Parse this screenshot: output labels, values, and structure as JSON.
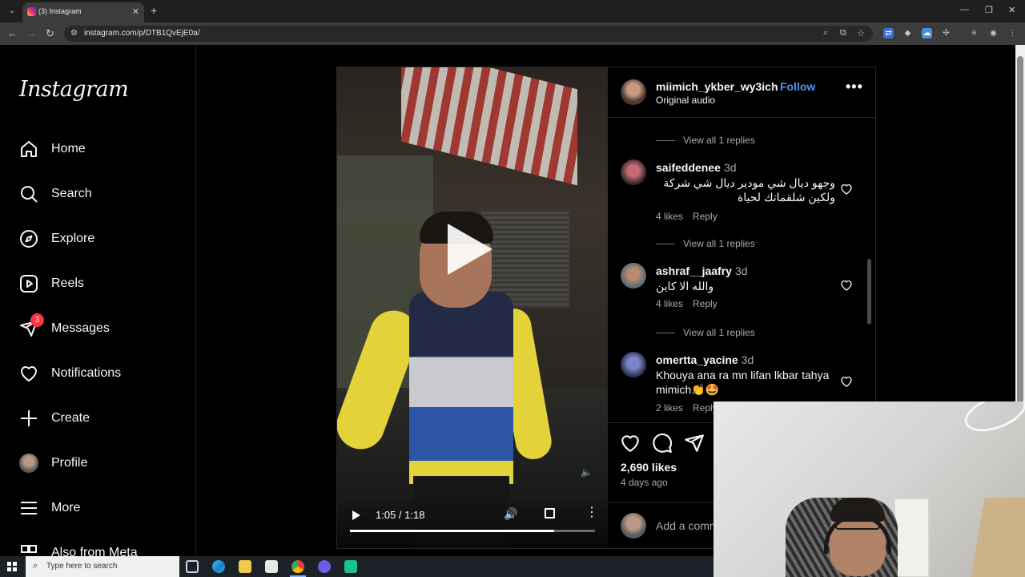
{
  "browser": {
    "tab_title": "(3) Instagram",
    "url": "instagram.com/p/DTB1QvEjE0a/"
  },
  "sidebar": {
    "logo": "Instagram",
    "items": [
      {
        "label": "Home",
        "icon": "home-icon"
      },
      {
        "label": "Search",
        "icon": "search-icon"
      },
      {
        "label": "Explore",
        "icon": "compass-icon"
      },
      {
        "label": "Reels",
        "icon": "reels-icon"
      },
      {
        "label": "Messages",
        "icon": "messenger-icon",
        "badge": "3"
      },
      {
        "label": "Notifications",
        "icon": "heart-icon"
      },
      {
        "label": "Create",
        "icon": "plus-icon"
      },
      {
        "label": "Profile",
        "icon": "avatar"
      },
      {
        "label": "More",
        "icon": "menu-icon"
      },
      {
        "label": "Also from Meta",
        "icon": "meta-icon"
      }
    ]
  },
  "video": {
    "time": "1:05 / 1:18",
    "progress": 0.833
  },
  "post": {
    "author": "miimich_ykber_wy3ich",
    "separator": "•",
    "follow_label": "Follow",
    "audio": "Original audio",
    "likes": "2,690 likes",
    "date": "4 days ago",
    "comment_placeholder": "Add a comment..."
  },
  "comments": {
    "view_replies_top": "View all 1 replies",
    "items": [
      {
        "user": "saifeddenee",
        "age": "3d",
        "text": "وجهو ديال شي مودير ديال شي شركة ولكين شلقماتك لحياة",
        "likes": "4 likes",
        "reply": "Reply",
        "view_replies": "View all 1 replies"
      },
      {
        "user": "ashraf__jaafry",
        "age": "3d",
        "text": "والله الا كاين",
        "likes": "4 likes",
        "reply": "Reply",
        "view_replies": "View all 1 replies"
      },
      {
        "user": "omertta_yacine",
        "age": "3d",
        "text": "Khouya ana ra mn lifan lkbar tahya mimich👏🤩",
        "likes": "2 likes",
        "reply": "Reply"
      }
    ]
  },
  "taskbar": {
    "search_placeholder": "Type here to search"
  },
  "colors": {
    "follow_blue": "#4a95f6",
    "badge_red": "#ff3040",
    "background": "#000000",
    "border": "#262626"
  }
}
